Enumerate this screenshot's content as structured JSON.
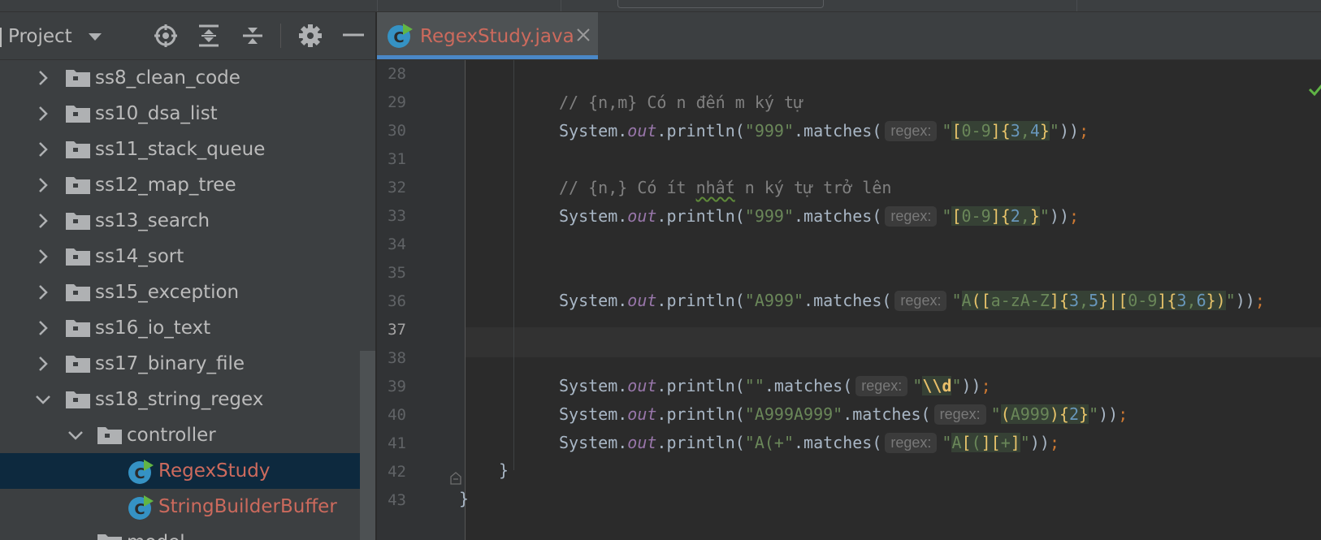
{
  "project_panel": {
    "title": "Project",
    "toolbar_icons": [
      "chevron-down-icon",
      "crosshair-icon",
      "expand-all-icon",
      "collapse-all-icon",
      "gear-icon",
      "minimize-icon"
    ],
    "items": [
      {
        "label": "ss8_clean_code",
        "type": "folder",
        "state": "collapsed"
      },
      {
        "label": "ss10_dsa_list",
        "type": "folder",
        "state": "collapsed"
      },
      {
        "label": "ss11_stack_queue",
        "type": "folder",
        "state": "collapsed"
      },
      {
        "label": "ss12_map_tree",
        "type": "folder",
        "state": "collapsed"
      },
      {
        "label": "ss13_search",
        "type": "folder",
        "state": "collapsed"
      },
      {
        "label": "ss14_sort",
        "type": "folder",
        "state": "collapsed"
      },
      {
        "label": "ss15_exception",
        "type": "folder",
        "state": "collapsed"
      },
      {
        "label": "ss16_io_text",
        "type": "folder",
        "state": "collapsed"
      },
      {
        "label": "ss17_binary_file",
        "type": "folder",
        "state": "collapsed"
      },
      {
        "label": "ss18_string_regex",
        "type": "folder",
        "state": "expanded"
      },
      {
        "label": "controller",
        "type": "package",
        "state": "expanded"
      },
      {
        "label": "RegexStudy",
        "type": "class",
        "selected": true
      },
      {
        "label": "StringBuilderBuffer",
        "type": "class"
      },
      {
        "label": "model",
        "type": "package"
      }
    ]
  },
  "editor": {
    "tab_label": "RegexStudy.java",
    "current_line": 37,
    "inlay_hint": "regex:",
    "lines": [
      {
        "n": "28"
      },
      {
        "n": "29"
      },
      {
        "n": "30"
      },
      {
        "n": "31"
      },
      {
        "n": "32"
      },
      {
        "n": "33"
      },
      {
        "n": "34"
      },
      {
        "n": "35"
      },
      {
        "n": "36"
      },
      {
        "n": "37"
      },
      {
        "n": "38"
      },
      {
        "n": "39"
      },
      {
        "n": "40"
      },
      {
        "n": "41"
      },
      {
        "n": "42"
      },
      {
        "n": "43"
      }
    ],
    "code": {
      "c29": "// {n,m} Có n đến m ký tự",
      "c32a": "// {n,} Có ít ",
      "c32b": "nhất",
      "c32c": " n ký tự trở lên",
      "sys": "System.",
      "out": "out",
      "println": ".println(",
      "matches": ".matches(",
      "end": "))",
      "semi": ";",
      "q": "\"",
      "s30": "\"999\"",
      "s33": "\"999\"",
      "s36": "\"A999\"",
      "s39": "\"\"",
      "s40": "\"A999A999\"",
      "s41": "\"A(+\"",
      "close42": "}",
      "close43": "}"
    }
  },
  "colors": {
    "editor_bg": "#2b2b2b",
    "panel_bg": "#3c3f41",
    "selection": "#0d293e",
    "accent": "#4a88c7",
    "modified_file": "#cc6a5d",
    "string": "#6a8759",
    "keyword": "#cc7832",
    "number": "#6897bb"
  }
}
